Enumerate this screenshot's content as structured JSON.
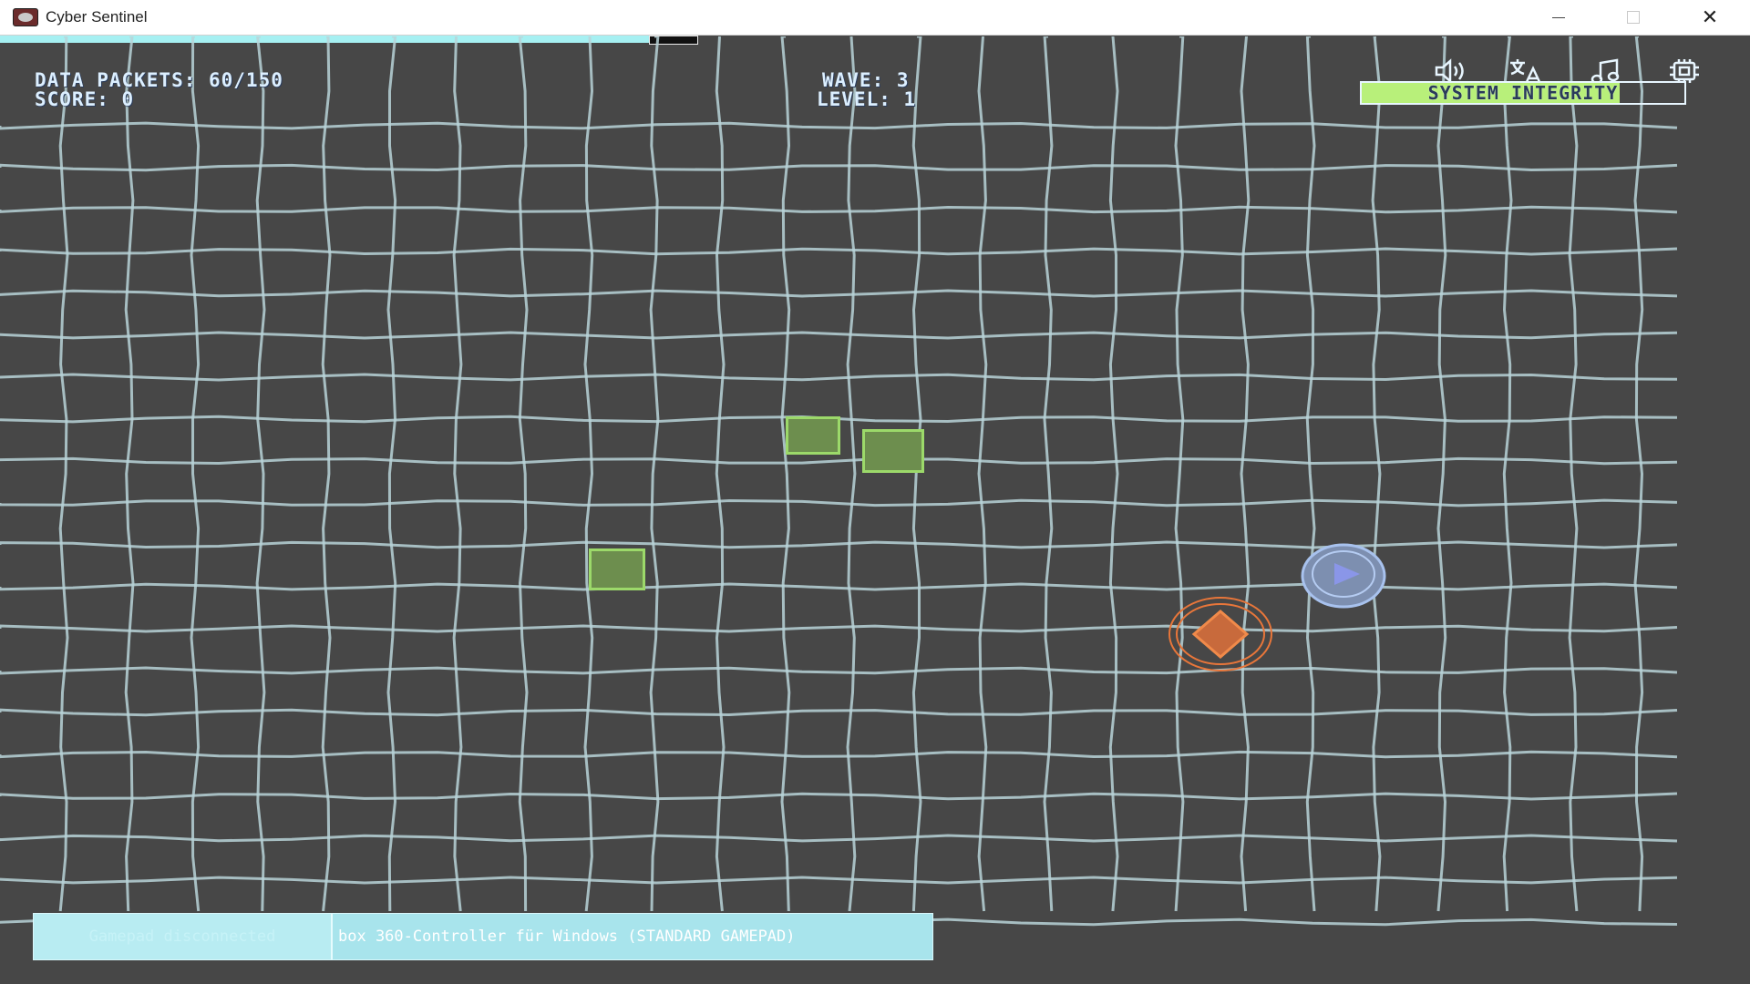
{
  "window": {
    "title": "Cyber Sentinel",
    "icon": "app-icon",
    "controls": [
      "minimize-icon",
      "maximize-icon",
      "close-icon"
    ]
  },
  "hud": {
    "data_packets": "DATA PACKETS: 60/150",
    "score": "SCORE: 0",
    "wave": "WAVE: 3",
    "level": "LEVEL: 1",
    "system_integrity_label": "SYSTEM INTEGRITY",
    "system_integrity_fraction": 0.8,
    "icons": [
      "sound-icon",
      "translate-icon",
      "music-icon",
      "settings-icon"
    ]
  },
  "notification": {
    "status": "Gamepad disconnected",
    "device": "box 360-Controller für Windows (STANDARD GAMEPAD)"
  },
  "colors": {
    "background": "#474747",
    "grid": "#b8d4d8",
    "packet_fill": "#6d8e4e",
    "packet_border": "#9cd96a",
    "player": "#e8763a",
    "enemy": "#9db8e6",
    "hud_text": "#dcefff",
    "integrity_fill": "#b8f07a",
    "toast": "#a8e4ec"
  }
}
